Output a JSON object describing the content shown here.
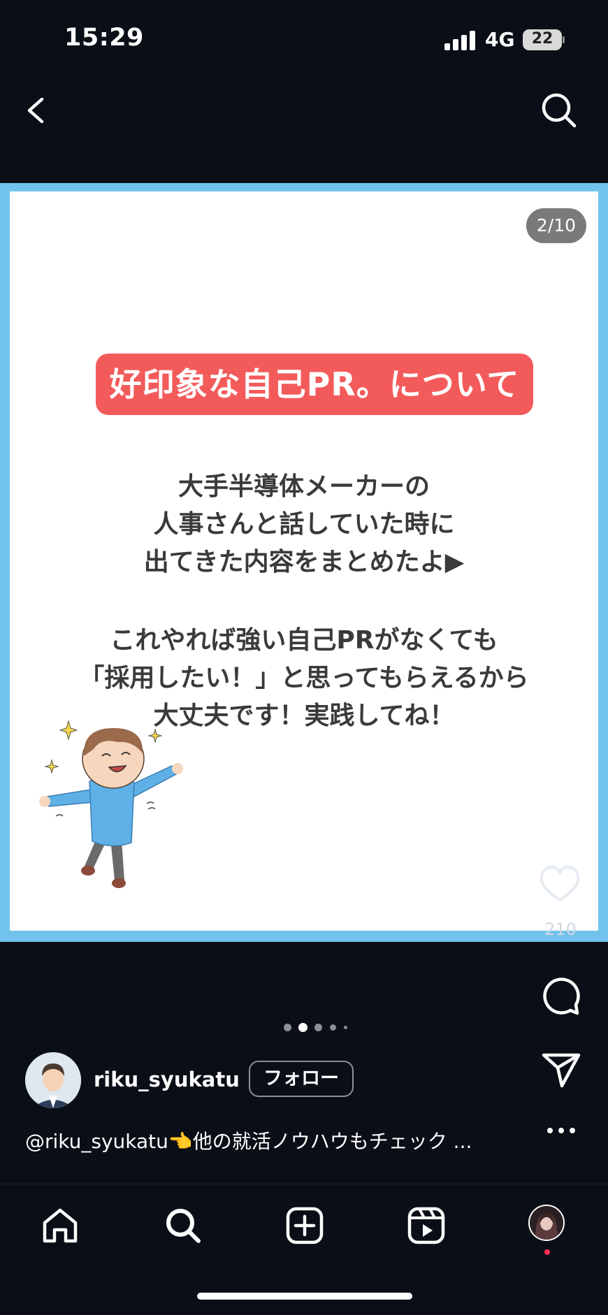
{
  "status_bar": {
    "time": "15:29",
    "network": "4G",
    "battery": "22"
  },
  "header": {
    "back_icon": "chevron-left-icon",
    "search_icon": "search-icon"
  },
  "post": {
    "slide_counter": "2/10",
    "title": "好印象な自己PR。について",
    "body_lines_1": [
      "大手半導体メーカーの",
      "人事さんと話していた時に",
      "出てきた内容をまとめたよ▶"
    ],
    "body_lines_2": [
      "これやれば強い自己PRがなくても",
      "「採用したい！」と思ってもらえるから",
      "大丈夫です！実践してね！"
    ],
    "like_count": "210",
    "carousel": {
      "total_visible_dots": 5,
      "active_index": 1
    }
  },
  "author": {
    "username": "riku_syukatu",
    "follow_label": "フォロー",
    "caption": "@riku_syukatu👈他の就活ノウハウもチェック ..."
  },
  "bottom_nav": {
    "items": [
      "home-icon",
      "search-icon",
      "add-post-icon",
      "reels-icon",
      "profile-avatar"
    ]
  },
  "colors": {
    "frame": "#71c3ec",
    "title_pill": "#f35b5b",
    "background": "#0a0e16",
    "notification_dot": "#ff2d55"
  }
}
